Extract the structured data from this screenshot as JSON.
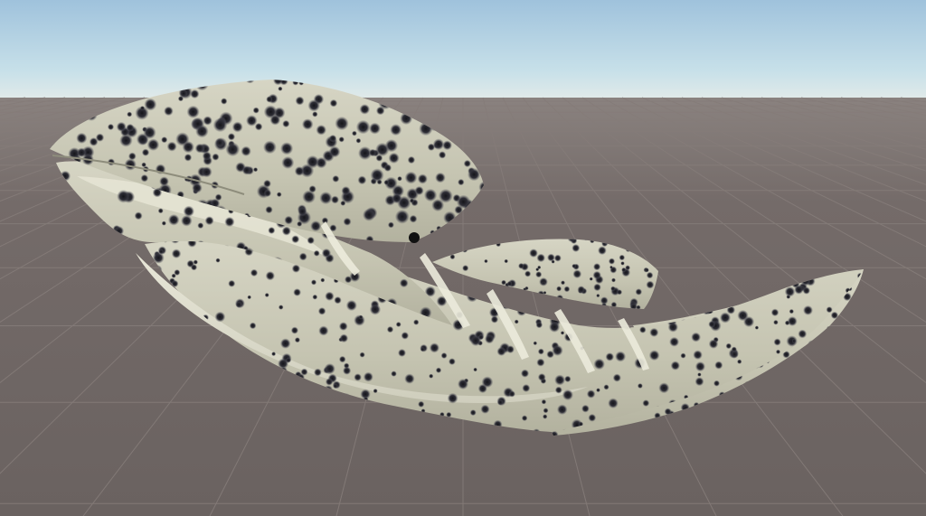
{
  "scene": {
    "colors": {
      "sky_top": "#9fc2dc",
      "sky_mid": "#c7e0e9",
      "horizon_haze": "#e3ebe9",
      "ground": "#6f6664",
      "ground_far": "#8a827f",
      "grid_line": "#857c79",
      "body_base": "#c9c8b6",
      "body_light": "#e2e1d2",
      "belly": "#d9d8c8",
      "spot_dark": "#1e1e22",
      "spot_mid": "#4d4d57",
      "stripe": "#ecebdc"
    },
    "icons": {
      "subject": "whale-shark-model-icon"
    }
  }
}
